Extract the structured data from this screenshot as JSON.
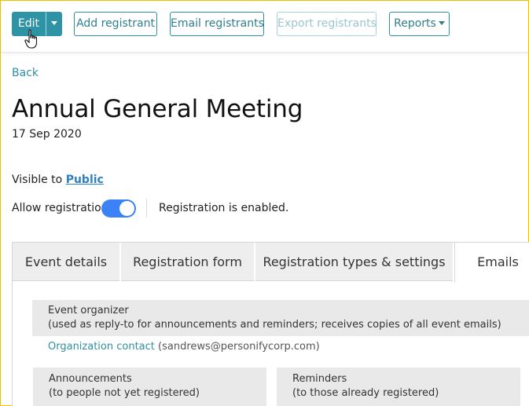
{
  "toolbar": {
    "edit_label": "Edit",
    "add_registrant_label": "Add registrant",
    "email_registrants_label": "Email registrants",
    "export_registrants_label": "Export registrants",
    "reports_label": "Reports"
  },
  "nav": {
    "back_label": "Back"
  },
  "event": {
    "title": "Annual General Meeting",
    "date": "17 Sep 2020"
  },
  "visibility": {
    "prefix": "Visible to",
    "value": "Public"
  },
  "registration": {
    "allow_label": "Allow registration",
    "enabled": true,
    "status_text": "Registration is enabled."
  },
  "tabs": [
    {
      "label": "Event details"
    },
    {
      "label": "Registration form"
    },
    {
      "label": "Registration types & settings"
    },
    {
      "label": "Emails",
      "active": true
    }
  ],
  "emails": {
    "organizer": {
      "title": "Event organizer",
      "subtitle": "(used as reply-to for announcements and reminders; receives copies of all event emails)",
      "contact_link": "Organization contact",
      "contact_email": "(sandrews@personifycorp.com)"
    },
    "announcements": {
      "title": "Announcements",
      "subtitle": "(to people not yet registered)"
    },
    "reminders": {
      "title": "Reminders",
      "subtitle": "(to those already registered)"
    }
  },
  "colors": {
    "accent": "#2f93a6",
    "toggle_on": "#3b82f6",
    "link": "#2f7fbf"
  }
}
